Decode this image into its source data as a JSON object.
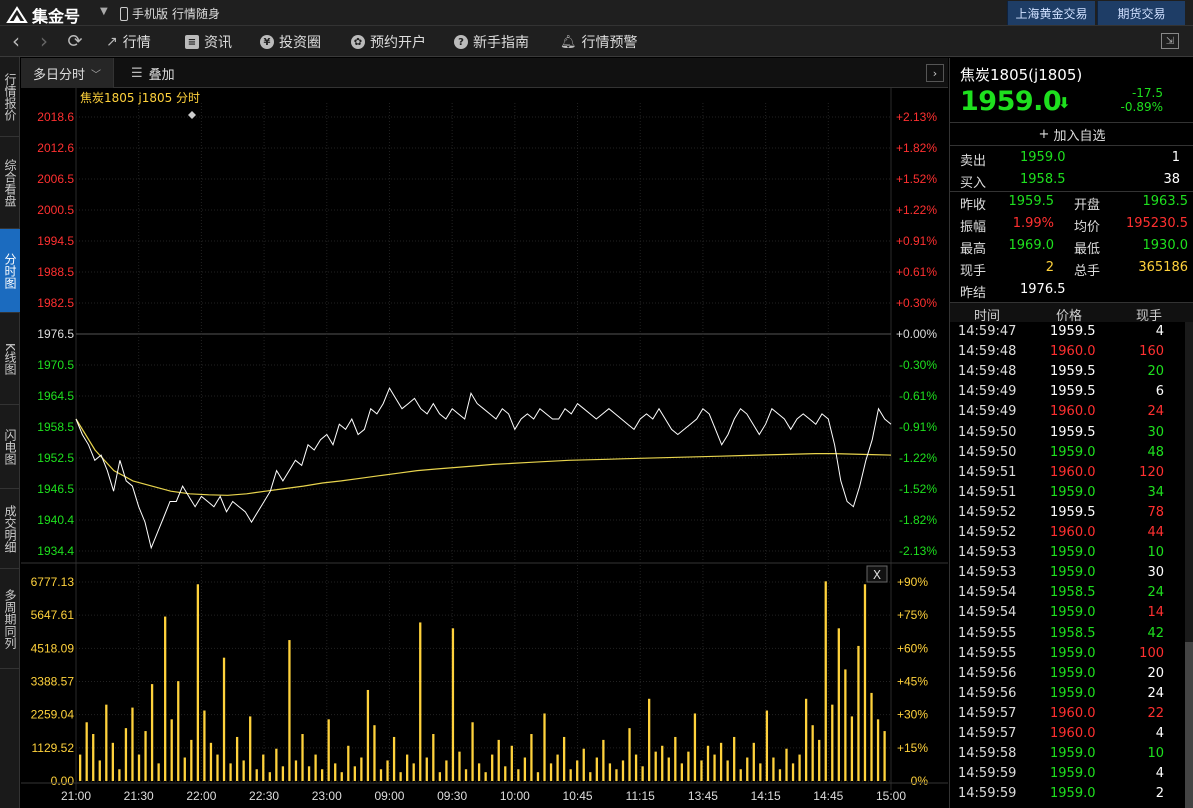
{
  "app": {
    "logo": "集金号",
    "mobile_label": "手机版",
    "mobile_slogan": "行情随身",
    "top_buttons": [
      "上海黄金交易",
      "期货交易"
    ]
  },
  "toolbar": {
    "items": [
      {
        "label": "行情",
        "icon": "chart-icon"
      },
      {
        "label": "资讯",
        "icon": "news-icon"
      },
      {
        "label": "投资圈",
        "icon": "yen-icon"
      },
      {
        "label": "预约开户",
        "icon": "gear-icon"
      },
      {
        "label": "新手指南",
        "icon": "help-icon"
      },
      {
        "label": "行情预警",
        "icon": "bell-icon"
      }
    ]
  },
  "sidebar": {
    "tabs": [
      {
        "label": "行情报价",
        "active": false
      },
      {
        "label": "综合看盘",
        "active": false
      },
      {
        "label": "分时图",
        "active": true
      },
      {
        "label": "K线图",
        "active": false
      },
      {
        "label": "闪电图",
        "active": false
      },
      {
        "label": "成交明细",
        "active": false
      },
      {
        "label": "多周期同列",
        "active": false
      }
    ]
  },
  "chart_tabs": {
    "multi_day": "多日分时",
    "overlay": "叠加"
  },
  "chart_data": {
    "type": "line",
    "title": "焦炭1805 j1805 分时",
    "prev_settle": 1976.5,
    "price_axis": {
      "ticks": [
        "2018.6",
        "2012.6",
        "2006.5",
        "2000.5",
        "1994.5",
        "1988.5",
        "1982.5",
        "1976.5",
        "1970.5",
        "1964.5",
        "1958.5",
        "1952.5",
        "1946.5",
        "1940.4",
        "1934.4"
      ],
      "pct": [
        "+2.13%",
        "+1.82%",
        "+1.52%",
        "+1.22%",
        "+0.91%",
        "+0.61%",
        "+0.30%",
        "+0.00%",
        "-0.30%",
        "-0.61%",
        "-0.91%",
        "-1.22%",
        "-1.52%",
        "-1.82%",
        "-2.13%"
      ],
      "ylim": [
        1934.4,
        2018.6
      ]
    },
    "volume_axis": {
      "ticks": [
        "6777.13",
        "5647.61",
        "4518.09",
        "3388.57",
        "2259.04",
        "1129.52",
        "0.00"
      ],
      "pct": [
        "+90%",
        "+75%",
        "+60%",
        "+45%",
        "+30%",
        "+15%",
        "0%"
      ],
      "ylim": [
        0,
        6777.13
      ]
    },
    "x_labels": [
      "21:00",
      "21:30",
      "22:00",
      "22:30",
      "23:00",
      "09:00",
      "09:30",
      "10:00",
      "10:45",
      "11:15",
      "13:45",
      "14:15",
      "14:45",
      "15:00"
    ],
    "price_series": [
      1960,
      1957,
      1955,
      1952,
      1953,
      1950,
      1946,
      1952,
      1948,
      1947,
      1943,
      1940,
      1935,
      1938,
      1941,
      1944,
      1944,
      1947,
      1945,
      1943,
      1945,
      1944,
      1943,
      1945,
      1942,
      1944,
      1943,
      1942,
      1940,
      1942,
      1944,
      1946,
      1950,
      1948,
      1950,
      1952,
      1951,
      1955,
      1954,
      1956,
      1957,
      1955,
      1959,
      1958,
      1960,
      1957,
      1958,
      1962,
      1961,
      1963,
      1966,
      1964,
      1962,
      1963,
      1964,
      1962,
      1961,
      1963,
      1961,
      1960,
      1962,
      1961,
      1960,
      1965,
      1963,
      1962,
      1961,
      1960,
      1962,
      1961,
      1958,
      1960,
      1961,
      1960,
      1962,
      1961,
      1960,
      1960,
      1962,
      1961,
      1963,
      1962,
      1961,
      1960,
      1961,
      1962,
      1961,
      1960,
      1959,
      1958,
      1960,
      1961,
      1960,
      1962,
      1960,
      1958,
      1957,
      1958,
      1959,
      1960,
      1962,
      1961,
      1958,
      1955,
      1957,
      1960,
      1962,
      1961,
      1959,
      1957,
      1959,
      1962,
      1961,
      1960,
      1958,
      1960,
      1961,
      1960,
      1959,
      1961,
      1960,
      1955,
      1948,
      1944,
      1943,
      1947,
      1952,
      1956,
      1962,
      1960,
      1959
    ],
    "avg_series": [
      1960,
      1954,
      1950,
      1948,
      1947,
      1946,
      1945.5,
      1945.3,
      1945.2,
      1945.5,
      1946,
      1946.5,
      1947,
      1947.6,
      1948,
      1948.5,
      1949,
      1949.5,
      1950,
      1950.3,
      1950.6,
      1950.9,
      1951.2,
      1951.4,
      1951.6,
      1951.8,
      1952,
      1952.1,
      1952.2,
      1952.3,
      1952.4,
      1952.5,
      1952.6,
      1952.7,
      1952.8,
      1952.9,
      1953,
      1953.1,
      1953.2,
      1953.3,
      1953.3,
      1953.2,
      1953.1,
      1953
    ],
    "volumes": [
      900,
      2000,
      1600,
      700,
      2600,
      1300,
      400,
      1800,
      2500,
      900,
      1700,
      3300,
      600,
      5600,
      2100,
      3400,
      800,
      1400,
      6700,
      2400,
      1300,
      900,
      4200,
      600,
      1500,
      700,
      2200,
      400,
      900,
      300,
      1100,
      500,
      4800,
      700,
      1600,
      500,
      900,
      400,
      2100,
      600,
      300,
      1200,
      500,
      800,
      3100,
      1900,
      400,
      700,
      1500,
      300,
      900,
      600,
      5400,
      800,
      1600,
      300,
      700,
      5200,
      1000,
      400,
      2000,
      600,
      300,
      900,
      1400,
      500,
      1200,
      400,
      800,
      1600,
      300,
      2300,
      600,
      900,
      1500,
      400,
      700,
      1100,
      300,
      800,
      1400,
      600,
      400,
      700,
      1800,
      900,
      500,
      2800,
      1000,
      1200,
      800,
      1500,
      600,
      1000,
      2300,
      700,
      1200,
      900,
      1300,
      700,
      1500,
      400,
      800,
      1300,
      600,
      2400,
      800,
      400,
      1100,
      600,
      900,
      2800,
      1900,
      1400,
      6800,
      2600,
      5200,
      3800,
      2200,
      4600,
      6700,
      3000,
      2100,
      1700
    ]
  },
  "quote": {
    "title": "焦炭1805(j1805)",
    "price": "1959.0",
    "change": "-17.5",
    "change_pct": "-0.89%",
    "add_fav": "加入自选",
    "sell_label": "卖出",
    "sell_price": "1959.0",
    "sell_vol": "1",
    "buy_label": "买入",
    "buy_price": "1958.5",
    "buy_vol": "38",
    "stats": [
      {
        "l1": "昨收",
        "v1": "1959.5",
        "c1": "g",
        "l2": "开盘",
        "v2": "1963.5",
        "c2": "g"
      },
      {
        "l1": "振幅",
        "v1": "1.99%",
        "c1": "r",
        "l2": "均价",
        "v2": "195230.5",
        "c2": "r"
      },
      {
        "l1": "最高",
        "v1": "1969.0",
        "c1": "g",
        "l2": "最低",
        "v2": "1930.0",
        "c2": "g"
      },
      {
        "l1": "现手",
        "v1": "2",
        "c1": "y",
        "l2": "总手",
        "v2": "365186",
        "c2": "y"
      }
    ],
    "settle_label": "昨结",
    "settle": "1976.5"
  },
  "ticks": {
    "headers": [
      "时间",
      "价格",
      "现手"
    ],
    "rows": [
      [
        "14:59:47",
        "1959.5",
        "w",
        "4",
        "w"
      ],
      [
        "14:59:48",
        "1960.0",
        "r",
        "160",
        "r"
      ],
      [
        "14:59:48",
        "1959.5",
        "w",
        "20",
        "g"
      ],
      [
        "14:59:49",
        "1959.5",
        "w",
        "6",
        "w"
      ],
      [
        "14:59:49",
        "1960.0",
        "r",
        "24",
        "r"
      ],
      [
        "14:59:50",
        "1959.5",
        "w",
        "30",
        "g"
      ],
      [
        "14:59:50",
        "1959.0",
        "g",
        "48",
        "g"
      ],
      [
        "14:59:51",
        "1960.0",
        "r",
        "120",
        "r"
      ],
      [
        "14:59:51",
        "1959.0",
        "g",
        "34",
        "g"
      ],
      [
        "14:59:52",
        "1959.5",
        "w",
        "78",
        "r"
      ],
      [
        "14:59:52",
        "1960.0",
        "r",
        "44",
        "r"
      ],
      [
        "14:59:53",
        "1959.0",
        "g",
        "10",
        "g"
      ],
      [
        "14:59:53",
        "1959.0",
        "g",
        "30",
        "w"
      ],
      [
        "14:59:54",
        "1958.5",
        "g",
        "24",
        "g"
      ],
      [
        "14:59:54",
        "1959.0",
        "g",
        "14",
        "r"
      ],
      [
        "14:59:55",
        "1958.5",
        "g",
        "42",
        "g"
      ],
      [
        "14:59:55",
        "1959.0",
        "g",
        "100",
        "r"
      ],
      [
        "14:59:56",
        "1959.0",
        "g",
        "20",
        "w"
      ],
      [
        "14:59:56",
        "1959.0",
        "g",
        "24",
        "w"
      ],
      [
        "14:59:57",
        "1960.0",
        "r",
        "22",
        "r"
      ],
      [
        "14:59:57",
        "1960.0",
        "r",
        "4",
        "w"
      ],
      [
        "14:59:58",
        "1959.0",
        "g",
        "10",
        "g"
      ],
      [
        "14:59:59",
        "1959.0",
        "g",
        "4",
        "w"
      ],
      [
        "14:59:59",
        "1959.0",
        "g",
        "2",
        "w"
      ]
    ]
  }
}
